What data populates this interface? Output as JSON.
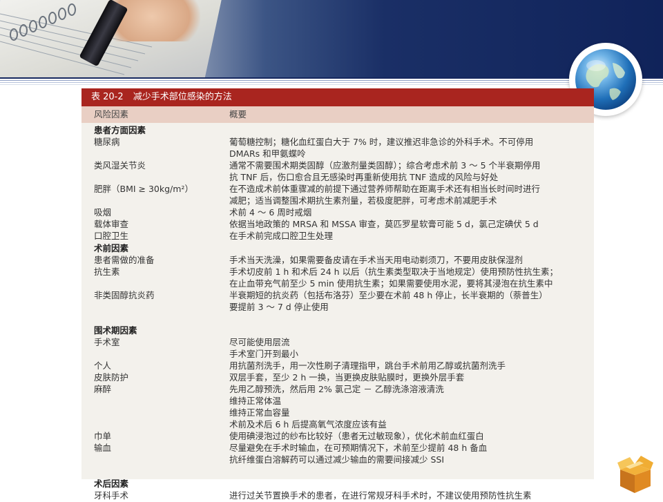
{
  "table": {
    "caption_number": "表 20-2",
    "caption_title": "减少手术部位感染的方法",
    "header": {
      "col_factor": "风险因素",
      "col_summary": "概要"
    },
    "rows": [
      {
        "factor": "患者方面因素",
        "summary": "",
        "section": true
      },
      {
        "factor": "糖尿病",
        "summary": "葡萄糖控制；糖化血红蛋白大于 7% 时，建议推迟非急诊的外科手术。不可停用"
      },
      {
        "factor": "",
        "summary": "DMARs 和甲氨蝶呤"
      },
      {
        "factor": "类风湿关节炎",
        "summary": "通常不需要围术期类固醇（应激剂量类固醇）；综合考虑术前 3 ～ 5 个半衰期停用"
      },
      {
        "factor": "",
        "summary": "抗 TNF 后，伤口愈合且无感染时再重新使用抗 TNF 造成的风险与好处"
      },
      {
        "factor": "肥胖（BMI ≥ 30kg/m²）",
        "summary": "在不造成术前体重骤减的前提下通过营养师帮助在距离手术还有相当长时间时进行"
      },
      {
        "factor": "",
        "summary": "减肥；适当调整围术期抗生素剂量，若极度肥胖，可考虑术前减肥手术"
      },
      {
        "factor": "吸烟",
        "summary": "术前 4 ～ 6 周时戒烟"
      },
      {
        "factor": "载体审查",
        "summary": "依据当地政策的 MRSA 和 MSSA 审查，莫匹罗星软膏可能 5 d，氯己定碘伏 5 d"
      },
      {
        "factor": "口腔卫生",
        "summary": "在手术前完成口腔卫生处理"
      },
      {
        "factor": "术前因素",
        "summary": "",
        "section": true
      },
      {
        "factor": "患者需做的准备",
        "summary": "手术当天洗澡，如果需要备皮请在手术当天用电动剃须刀，不要用皮肤保湿剂"
      },
      {
        "factor": "抗生素",
        "summary": "手术切皮前 1 h 和术后 24 h 以后（抗生素类型取决于当地规定）使用预防性抗生素；"
      },
      {
        "factor": "",
        "summary": "在止血带充气前至少 5 min 使用抗生素；如果需要使用水泥，要将其浸泡在抗生素中"
      },
      {
        "factor": "非类固醇抗炎药",
        "summary": "半衰期短的抗炎药（包括布洛芬）至少要在术前 48 h 停止，长半衰期的（萘普生）"
      },
      {
        "factor": "",
        "summary": "要提前 3 ～ 7 d 停止使用"
      },
      {
        "factor": "",
        "summary": ""
      },
      {
        "factor": "围术期因素",
        "summary": "",
        "section": true
      },
      {
        "factor": "手术室",
        "summary": "尽可能使用层流"
      },
      {
        "factor": "",
        "summary": "手术室门开到最小"
      },
      {
        "factor": "个人",
        "summary": "用抗菌剂洗手，用一次性刷子清理指甲，跳台手术前用乙醇或抗菌剂洗手"
      },
      {
        "factor": "皮肤防护",
        "summary": "双层手套，至少 2 h 一换，当更换皮肤贴膜时，更换外层手套"
      },
      {
        "factor": "麻醉",
        "summary": "先用乙醇预洗，然后用 2% 氯己定 － 乙醇洗涤溶液清洗"
      },
      {
        "factor": "",
        "summary": "维持正常体温"
      },
      {
        "factor": "",
        "summary": "维持正常血容量"
      },
      {
        "factor": "",
        "summary": "术前及术后 6 h 后提高氧气浓度应该有益"
      },
      {
        "factor": "巾单",
        "summary": "使用碘浸泡过的纱布比较好（患者无过敏现象），优化术前血红蛋白"
      },
      {
        "factor": "输血",
        "summary": "尽量避免在手术时输血，在可预期情况下，术前至少提前 48 h 备血"
      },
      {
        "factor": "",
        "summary": "抗纤维蛋白溶解药可以通过减少输血的需要间接减少 SSI"
      },
      {
        "factor": "",
        "summary": ""
      },
      {
        "factor": "术后因素",
        "summary": "",
        "section": true
      },
      {
        "factor": "牙科手术",
        "summary": "进行过关节置换手术的患者，在进行常规牙科手术时，不建议使用预防性抗生素"
      }
    ]
  },
  "decor": {
    "banner_image": "hand-writing-on-notebook",
    "globe_icon": "globe-icon",
    "box_icon": "gift-box-icon",
    "colors": {
      "caption_bg": "#a9251f",
      "header_bg": "#e9cfc4",
      "banner_dark": "#10235a",
      "paper": "#f3f1ec"
    }
  }
}
